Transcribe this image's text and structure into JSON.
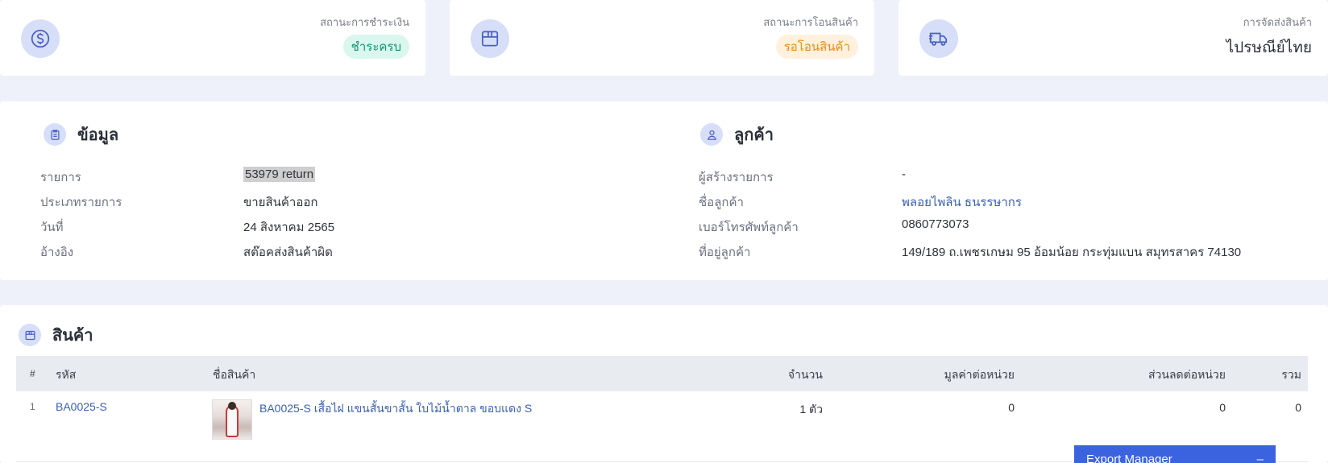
{
  "status_cards": {
    "payment": {
      "label": "สถานะการชำระเงิน",
      "badge": "ชำระครบ",
      "icon": "dollar-circle-icon",
      "badge_color": "#15936e"
    },
    "transfer": {
      "label": "สถานะการโอนสินค้า",
      "badge": "รอโอนสินค้า",
      "icon": "box-icon",
      "badge_color": "#ea8a1c"
    },
    "shipping": {
      "label": "การจัดส่งสินค้า",
      "value": "ไปรษณีย์ไทย",
      "icon": "truck-icon"
    }
  },
  "info": {
    "title": "ข้อมูล",
    "icon": "clipboard-icon",
    "fields": [
      {
        "label": "รายการ",
        "value": "53979 return"
      },
      {
        "label": "ประเภทรายการ",
        "value": "ขายสินค้าออก"
      },
      {
        "label": "วันที่",
        "value": "24 สิงหาคม 2565"
      },
      {
        "label": "อ้างอิง",
        "value": "สต๊อคส่งสินค้าผิด"
      }
    ]
  },
  "customer": {
    "title": "ลูกค้า",
    "icon": "user-icon",
    "fields": [
      {
        "label": "ผู้สร้างรายการ",
        "value": "-"
      },
      {
        "label": "ชื่อลูกค้า",
        "value": "พลอยไพลิน ธนรรษากร"
      },
      {
        "label": "เบอร์โทรศัพท์ลูกค้า",
        "value": "0860773073"
      },
      {
        "label": "ที่อยู่ลูกค้า",
        "value": "149/189 ถ.เพชรเกษม 95 อ้อมน้อย กระทุ่มแบน สมุทรสาคร 74130"
      }
    ]
  },
  "products": {
    "title": "สินค้า",
    "icon": "box-icon",
    "columns": [
      "#",
      "รหัส",
      "ชื่อสินค้า",
      "จำนวน",
      "มูลค่าต่อหน่วย",
      "ส่วนลดต่อหน่วย",
      "รวม"
    ],
    "rows": [
      {
        "no": "1",
        "code": "BA0025-S",
        "name": "BA0025-S เสื้อไฝ แขนสั้นขาสั้น ใบไม้น้ำตาล ขอบแดง S",
        "qty": "1 ตัว",
        "unit_price": "0",
        "discount": "0",
        "total": "0"
      }
    ]
  },
  "export_manager": {
    "label": "Export Manager",
    "toggle": "–"
  },
  "colors": {
    "accent": "#3b63e0",
    "link": "#3a5fb5",
    "icon_bg": "#d7def8"
  }
}
